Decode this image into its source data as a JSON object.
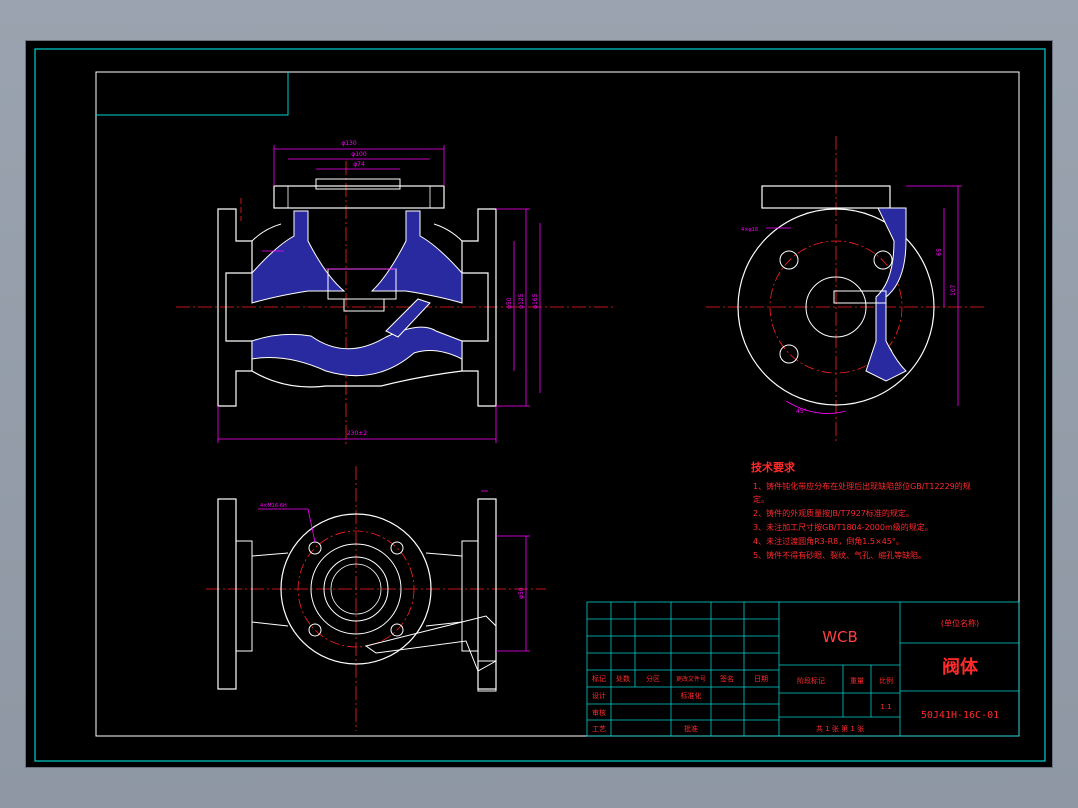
{
  "colors": {
    "background": "#000000",
    "frame": "#00d0d0",
    "outline": "#ffffff",
    "dimension": "#ff00ff",
    "centerline": "#ff2020",
    "hatch": "#5050ff",
    "table_text": "#ff2a2a"
  },
  "notes": {
    "title": "技术要求",
    "lines": [
      "1、铸件钝化带应分布在处理后出现缺陷部位GB/T12229的规",
      "定。",
      "2、铸件的外观质量按JB/T7927标准的规定。",
      "3、未注加工尺寸按GB/T1804-2000m级的规定。",
      "4、未注过渡圆角R3-R8，倒角1.5×45°。",
      "5、铸件不得有砂眼、裂纹、气孔、缩孔等缺陷。"
    ]
  },
  "title_block": {
    "material": "WCB",
    "unit_name": "(单位名称)",
    "part_name": "阀体",
    "drawing_number": "50J41H-16C-01",
    "scale": "1:1",
    "sheet_info": "共 1 张  第 1 张",
    "headers": {
      "mark": "标记",
      "count": "处数",
      "zone": "分区",
      "change_doc": "更改文件号",
      "signature": "签名",
      "date": "日期",
      "design": "设计",
      "standardize": "标准化",
      "review": "审核",
      "process": "工艺",
      "approve": "批准",
      "stage_mark": "阶段标记",
      "weight": "重量",
      "scale_label": "比例"
    }
  },
  "dimensions": {
    "front_overall_length": "230±2",
    "front_top_width": "φ130",
    "front_top_2": "φ100",
    "front_top_3": "φ74",
    "side_height": "65",
    "side_height2": "107",
    "flange_dia": "φ165",
    "flange_dia2": "φ125",
    "flange_dia3": "φ50",
    "angle": "45°",
    "bolt_holes": "4×M16-6H",
    "bolt_holes_side": "4×φ18",
    "plan_dim": "φ50"
  }
}
